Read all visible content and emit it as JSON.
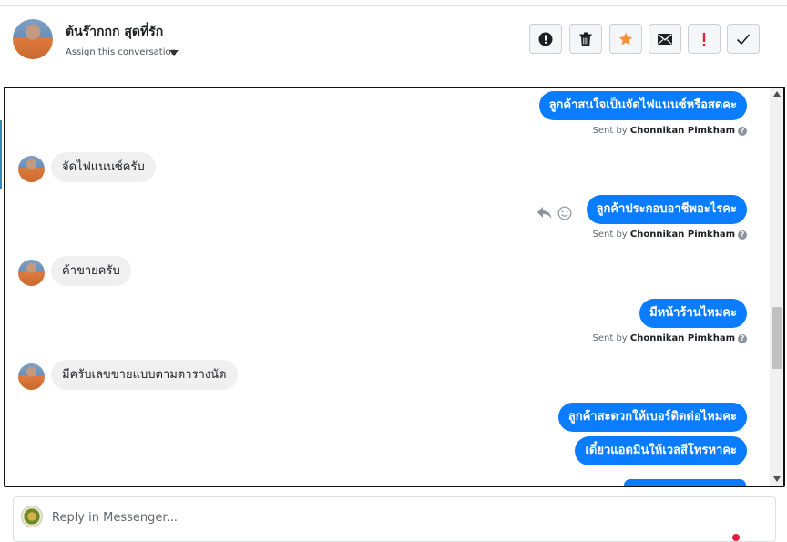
{
  "header": {
    "contact_name": "ต้นร๊ากกก สุดที่รัก",
    "assign_label": "Assign this conversation",
    "actions": [
      {
        "name": "report-spam",
        "icon": "exclamation-circle-icon"
      },
      {
        "name": "delete",
        "icon": "trash-icon"
      },
      {
        "name": "star",
        "icon": "star-icon",
        "color": "#f7923b"
      },
      {
        "name": "mark-unread",
        "icon": "envelope-icon"
      },
      {
        "name": "follow-up",
        "icon": "exclamation-icon",
        "color": "#e41e3f"
      },
      {
        "name": "mark-done",
        "icon": "checkmark-icon"
      }
    ]
  },
  "conversation": {
    "sent_prefix": "Sent by",
    "sender": "Chonnikan Pimkham",
    "messages": [
      {
        "direction": "out",
        "text": "ลูกค้าสนใจเป็นจัดไฟแนนซ์หรือสดคะ"
      },
      {
        "direction": "in",
        "text": "จัดไฟแนนซ์ครับ"
      },
      {
        "direction": "out",
        "text": "ลูกค้าประกอบอาชีพอะไรคะ"
      },
      {
        "direction": "in",
        "text": "ค้าขายครับ"
      },
      {
        "direction": "out",
        "text": "มีหน้าร้านไหมคะ"
      },
      {
        "direction": "in",
        "text": "มีครับเลขขายแบบตามตารางนัด"
      },
      {
        "direction": "out",
        "text": "ลูกค้าสะดวกให้เบอร์ติดต่อไหมคะ"
      },
      {
        "direction": "out",
        "text": "เดี๋ยวแอดมินให้เวลสีโทรหาคะ"
      }
    ]
  },
  "reply": {
    "placeholder": "Reply in Messenger..."
  },
  "colors": {
    "outgoing_bubble": "#0a7cff",
    "incoming_bubble": "#f0f0f0",
    "star": "#f7923b",
    "alert": "#e41e3f"
  }
}
